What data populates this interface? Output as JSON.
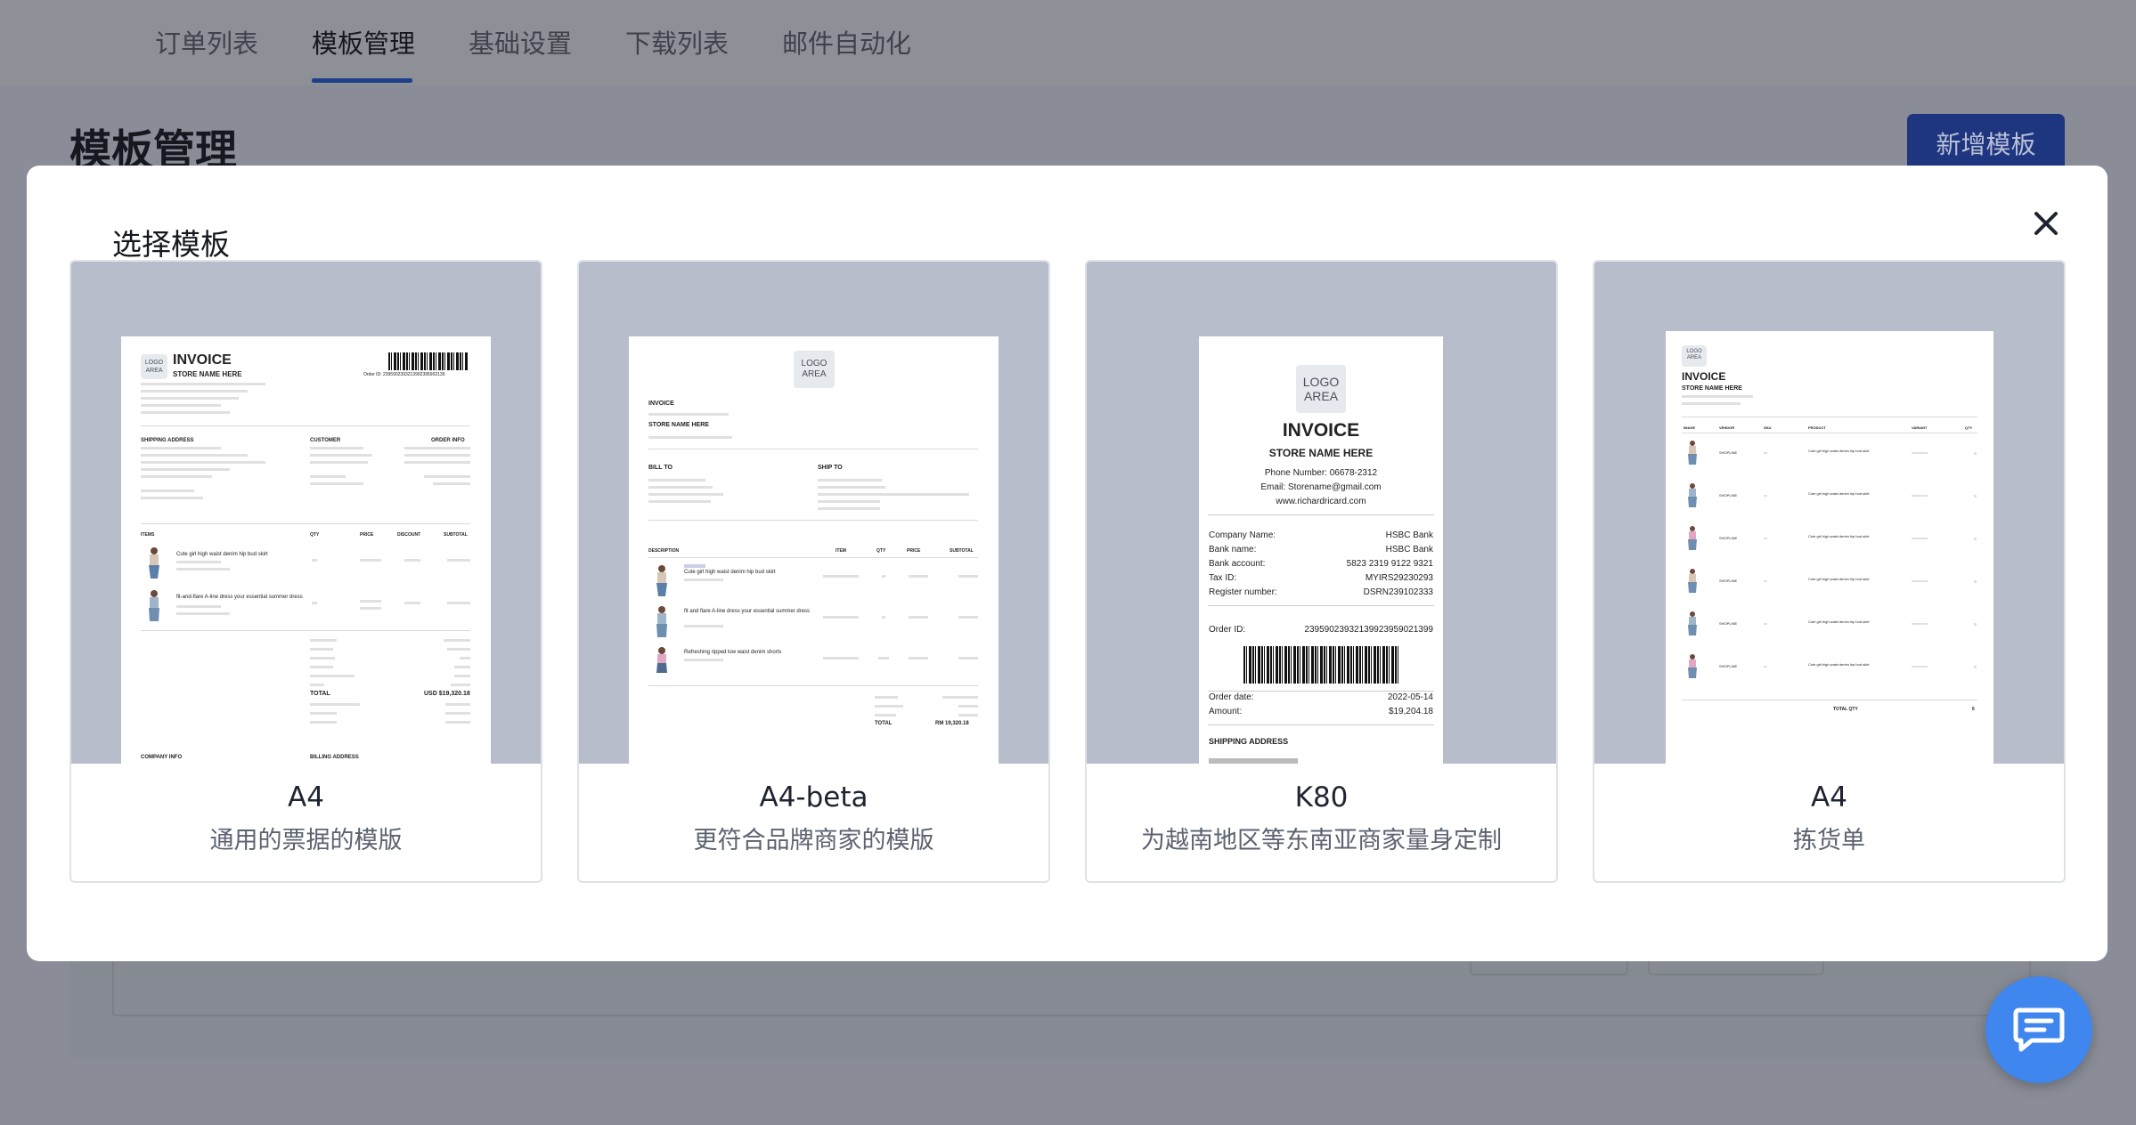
{
  "nav": {
    "tabs": [
      {
        "label": "订单列表"
      },
      {
        "label": "模板管理",
        "active": true
      },
      {
        "label": "基础设置"
      },
      {
        "label": "下载列表"
      },
      {
        "label": "邮件自动化"
      }
    ]
  },
  "page": {
    "title": "模板管理",
    "add_button": "新增模板"
  },
  "modal": {
    "title": "选择模板",
    "close_icon": "close-icon",
    "cards": [
      {
        "name": "A4",
        "desc": "通用的票据的模版"
      },
      {
        "name": "A4-beta",
        "desc": "更符合品牌商家的模版"
      },
      {
        "name": "K80",
        "desc": "为越南地区等东南亚商家量身定制"
      },
      {
        "name": "A4",
        "desc": "拣货单"
      }
    ]
  },
  "previews": {
    "a4": {
      "logo": "LOGO AREA",
      "title": "INVOICE",
      "store": "STORE NAME HERE",
      "order_id": "Order ID: 2395902393213992395902139",
      "shipping": "SHIPPING ADDRESS",
      "customer": "CUSTOMER",
      "order_info": "ORDER INFO",
      "cols": [
        "ITEMS",
        "QTY",
        "PRICE",
        "DISCOUNT",
        "SUBTOTAL"
      ],
      "item1": "Cute girl high waist denim hip bud skirt",
      "item2": "fit-and-flare A-line dress your essential summer dress",
      "total_label": "TOTAL",
      "total_value": "USD $19,320.18",
      "company": "COMPANY INFO",
      "billing": "BILLING ADDRESS"
    },
    "a4beta": {
      "logo": "LOGO AREA",
      "title": "INVOICE",
      "store": "STORE NAME HERE",
      "bill_to": "BILL TO",
      "ship_to": "SHIP TO",
      "cols": [
        "DESCRIPTION",
        "ITEM",
        "QTY",
        "PRICE",
        "SUBTOTAL"
      ],
      "item1": "Cute girl high waist denim hip bud skirt",
      "item2": "fit and flare A-line dress your essential summer dress",
      "item3": "Refreshing ripped low waist denim shorts",
      "total_label": "TOTAL",
      "total_value": "RM 19,320.18"
    },
    "k80": {
      "logo": "LOGO AREA",
      "title": "INVOICE",
      "store": "STORE NAME HERE",
      "phone": "Phone Number: 06678-2312",
      "email": "Email: Storename@gmail.com",
      "web": "www.richardricard.com",
      "rows": [
        {
          "k": "Company Name:",
          "v": "HSBC Bank"
        },
        {
          "k": "Bank name:",
          "v": "HSBC Bank"
        },
        {
          "k": "Bank account:",
          "v": "5823 2319 9122 9321"
        },
        {
          "k": "Tax ID:",
          "v": "MYIRS29230293"
        },
        {
          "k": "Register number:",
          "v": "DSRN239102333"
        }
      ],
      "order_id_label": "Order ID:",
      "order_id": "23959023932139923959021399",
      "order_date_label": "Order date:",
      "order_date": "2022-05-14",
      "amount_label": "Amount:",
      "amount": "$19,204.18",
      "shipping": "SHIPPING ADDRESS"
    },
    "pick": {
      "logo": "LOGO AREA",
      "title": "INVOICE",
      "store": "STORE NAME HERE",
      "cols": [
        "IMAGE",
        "VENDOR",
        "SKU",
        "PRODUCT",
        "VARIANT",
        "QTY"
      ],
      "vendor": "SHOPLINE",
      "product": "Cute girl high waist denim hip bud skirt",
      "total_label": "TOTAL QTY",
      "total_value": "6"
    }
  },
  "chat_fab": {
    "icon": "chat-icon"
  },
  "colors": {
    "accent": "#1e3f8a",
    "fab": "#3f86ee",
    "preview_bg": "#b8bdcb"
  }
}
